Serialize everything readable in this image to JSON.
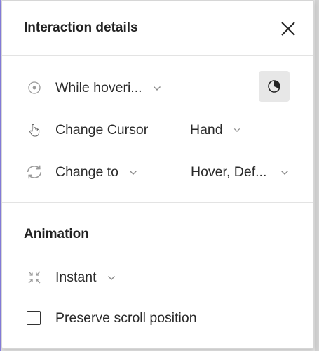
{
  "panel": {
    "title": "Interaction details"
  },
  "trigger": {
    "label": "While hoveri...",
    "icon": "target-circle-icon"
  },
  "cursor_action": {
    "label": "Change Cursor",
    "value": "Hand",
    "icon": "hand-pointer-icon"
  },
  "change_to": {
    "label": "Change to",
    "value": "Hover, Def...",
    "icon": "swap-arrows-icon"
  },
  "animation": {
    "section_title": "Animation",
    "type_label": "Instant",
    "icon": "instant-collapse-icon"
  },
  "options": {
    "preserve_scroll_label": "Preserve scroll position",
    "preserve_scroll_checked": false
  },
  "colors": {
    "icon_gray": "#9a9a9a",
    "text": "#2a2a2a",
    "button_bg": "#e7e7e7",
    "canvas_accent": "#8b83e6"
  }
}
